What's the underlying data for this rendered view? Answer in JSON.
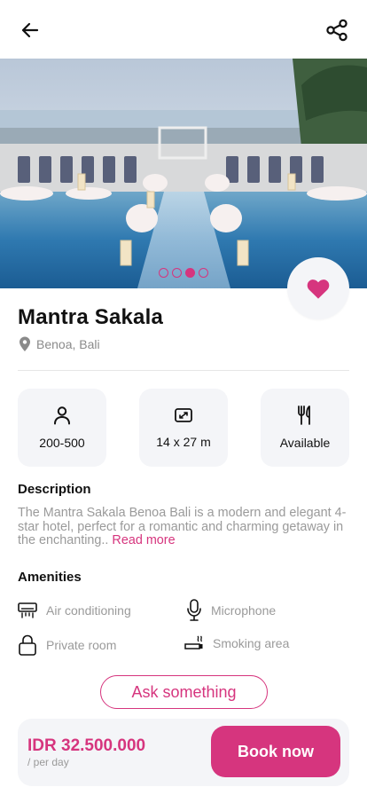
{
  "hero": {
    "image_alt": "Poolside wedding venue with chairs and flower arrangements at sunset by the sea",
    "slide_count": 4,
    "active_slide": 3
  },
  "venue": {
    "name": "Mantra Sakala",
    "location": "Benoa, Bali"
  },
  "specs": [
    {
      "icon": "person-icon",
      "label": "200-500"
    },
    {
      "icon": "area-icon",
      "label": "14 x 27 m"
    },
    {
      "icon": "utensils-icon",
      "label": "Available"
    }
  ],
  "description": {
    "title": "Description",
    "text": "The Mantra Sakala Benoa Bali is a modern and elegant 4-star hotel, perfect for a romantic and charming getaway in the enchanting..",
    "read_more": " Read more"
  },
  "amenities": {
    "title": "Amenities",
    "items": [
      {
        "icon": "air-conditioner-icon",
        "label": "Air conditioning"
      },
      {
        "icon": "microphone-icon",
        "label": "Microphone"
      },
      {
        "icon": "lock-icon",
        "label": "Private room"
      },
      {
        "icon": "smoking-icon",
        "label": "Smoking area"
      }
    ]
  },
  "actions": {
    "ask": "Ask something",
    "book": "Book now"
  },
  "pricing": {
    "price": "IDR 32.500.000",
    "unit": "/ per day"
  },
  "colors": {
    "accent": "#d6357e",
    "card": "#f4f5f8",
    "muted": "#9a9a9a"
  }
}
